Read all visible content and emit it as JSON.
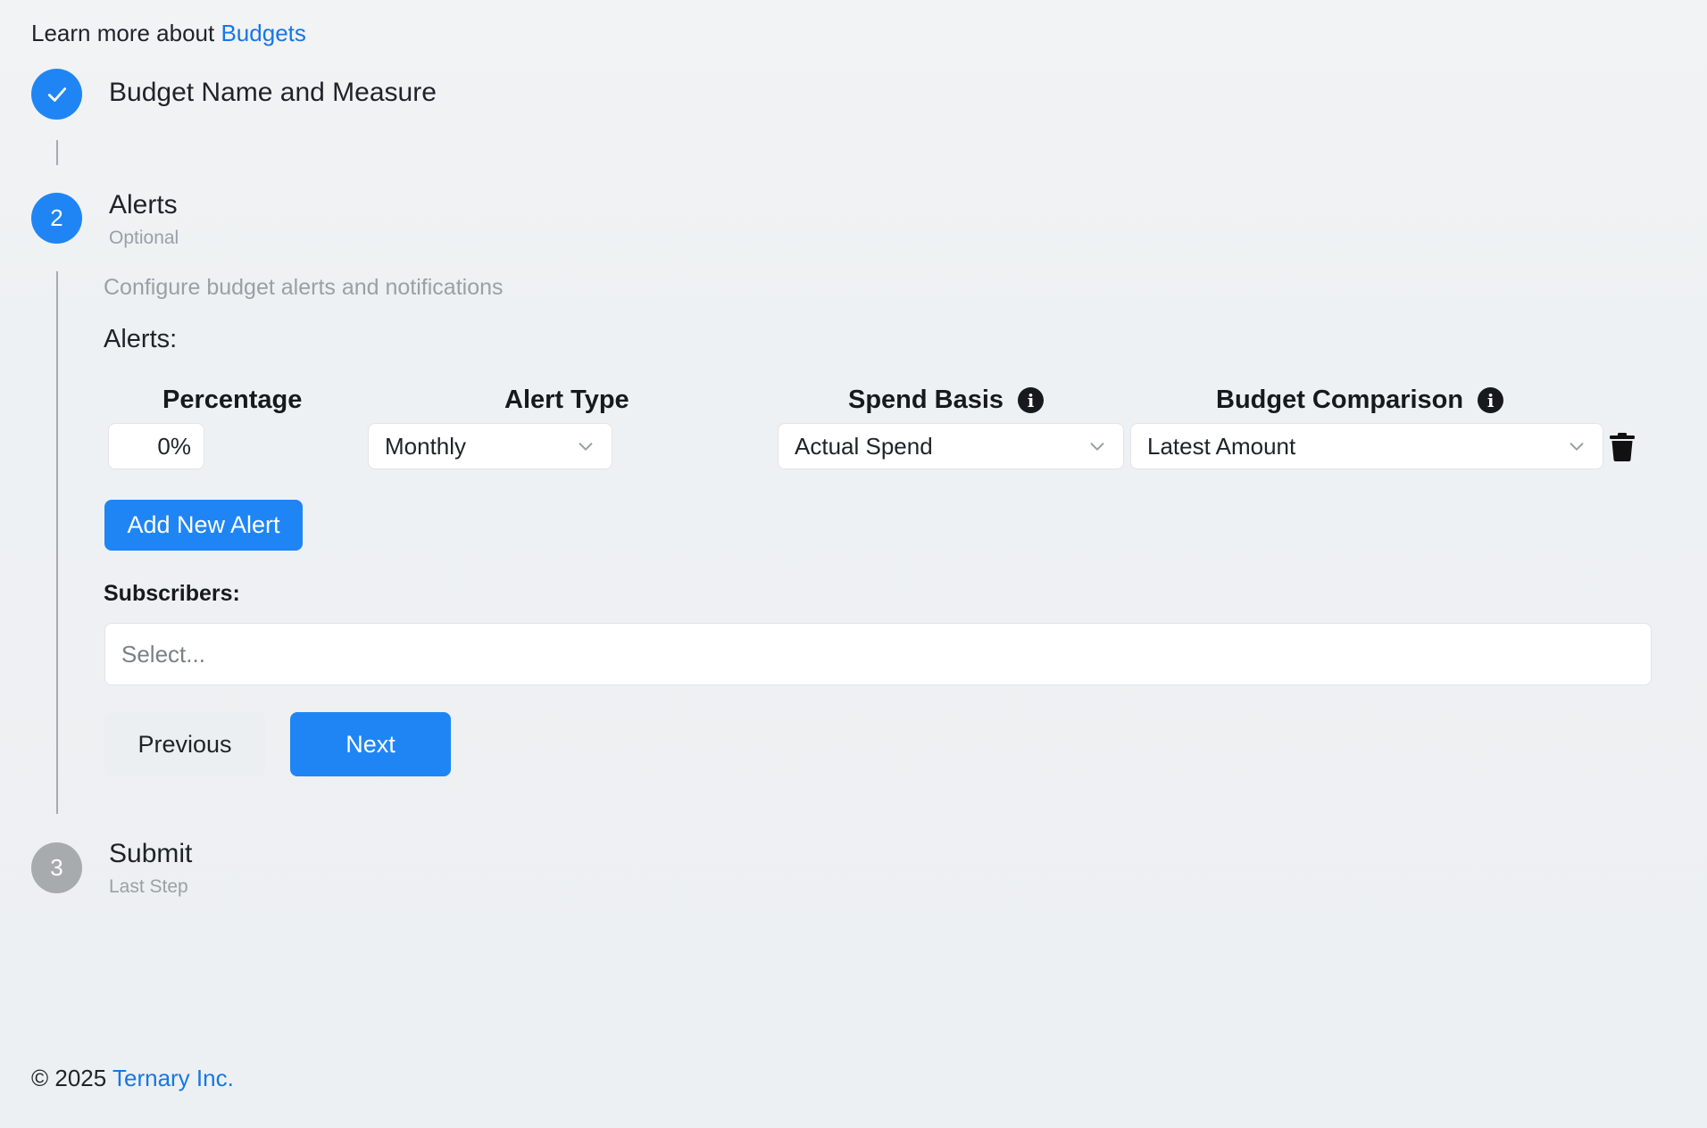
{
  "header": {
    "learn_more_prefix": "Learn more about ",
    "learn_more_link": "Budgets"
  },
  "steps": [
    {
      "title": "Budget Name and Measure",
      "subtitle": "",
      "status": "complete",
      "icon": "check-icon"
    },
    {
      "number": "2",
      "title": "Alerts",
      "subtitle": "Optional",
      "status": "active"
    },
    {
      "number": "3",
      "title": "Submit",
      "subtitle": "Last Step",
      "status": "pending"
    }
  ],
  "alerts_step": {
    "description": "Configure budget alerts and notifications",
    "alerts_label": "Alerts:",
    "columns": {
      "percentage": "Percentage",
      "alert_type": "Alert Type",
      "spend_basis": "Spend Basis",
      "budget_comparison": "Budget Comparison"
    },
    "alert_row": {
      "percentage": "0%",
      "alert_type": "Monthly",
      "spend_basis": "Actual Spend",
      "budget_comparison": "Latest Amount"
    },
    "add_alert_label": "Add New Alert",
    "subscribers_label": "Subscribers:",
    "subscribers_placeholder": "Select...",
    "previous_label": "Previous",
    "next_label": "Next"
  },
  "footer": {
    "copyright": "© 2025 ",
    "company": "Ternary Inc."
  },
  "colors": {
    "accent": "#1f85f5",
    "link": "#1677e6",
    "pending_step": "#a8abae"
  }
}
